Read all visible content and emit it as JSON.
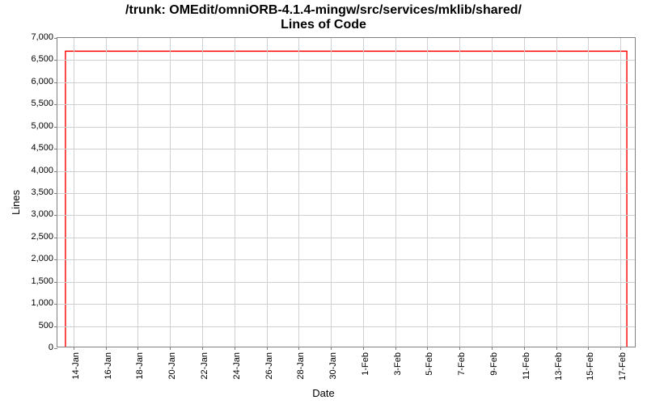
{
  "chart_data": {
    "type": "line",
    "title_line1": "/trunk: OMEdit/omniORB-4.1.4-mingw/src/services/mklib/shared/",
    "title_line2": "Lines of Code",
    "xlabel": "Date",
    "ylabel": "Lines",
    "ylim": [
      0,
      7000
    ],
    "y_ticks": [
      0,
      500,
      1000,
      1500,
      2000,
      2500,
      3000,
      3500,
      4000,
      4500,
      5000,
      5500,
      6000,
      6500,
      7000
    ],
    "y_tick_labels": [
      "0",
      "500",
      "1,000",
      "1,500",
      "2,000",
      "2,500",
      "3,000",
      "3,500",
      "4,000",
      "4,500",
      "5,000",
      "5,500",
      "6,000",
      "6,500",
      "7,000"
    ],
    "x_categories": [
      "14-Jan",
      "16-Jan",
      "18-Jan",
      "20-Jan",
      "22-Jan",
      "24-Jan",
      "26-Jan",
      "28-Jan",
      "30-Jan",
      "1-Feb",
      "3-Feb",
      "5-Feb",
      "7-Feb",
      "9-Feb",
      "11-Feb",
      "13-Feb",
      "15-Feb",
      "17-Feb"
    ],
    "x_index_range": [
      13,
      49
    ],
    "series": [
      {
        "name": "Lines of Code",
        "color": "#ff0000",
        "points": [
          {
            "xi": 13.5,
            "y": 0
          },
          {
            "xi": 13.5,
            "y": 6700
          },
          {
            "xi": 48.5,
            "y": 6700
          },
          {
            "xi": 48.5,
            "y": 0
          }
        ]
      }
    ]
  }
}
